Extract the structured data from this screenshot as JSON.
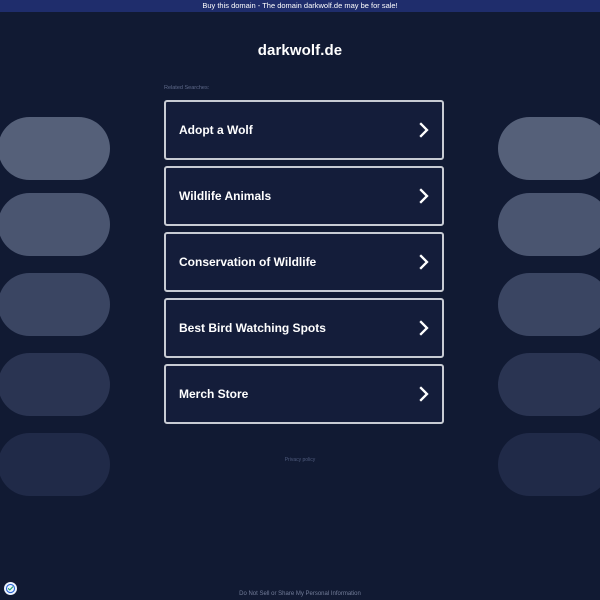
{
  "banner": {
    "text": "Buy this domain - The domain darkwolf.de may be for sale!"
  },
  "site": {
    "title": "darkwolf.de"
  },
  "related": {
    "label": "Related Searches:",
    "items": [
      {
        "label": "Adopt a Wolf",
        "icon": "chevron-right-icon"
      },
      {
        "label": "Wildlife Animals",
        "icon": "chevron-right-icon"
      },
      {
        "label": "Conservation of Wildlife",
        "icon": "chevron-right-icon"
      },
      {
        "label": "Best Bird Watching Spots",
        "icon": "chevron-right-icon"
      },
      {
        "label": "Merch Store",
        "icon": "chevron-right-icon"
      }
    ]
  },
  "links": {
    "privacy_policy": "Privacy policy",
    "do_not_sell": "Do Not Sell or Share My Personal Information"
  },
  "icons": {
    "consent": "consent-check-icon",
    "chevron": "chevron-right-icon"
  },
  "colors": {
    "background": "#111a33",
    "banner": "#1f2d6c",
    "card_border": "#c7cbd3",
    "pill_1": "#556079",
    "pill_2": "#4a5570",
    "pill_3": "#3a4562",
    "pill_4": "#2a3452",
    "pill_5": "#202a48"
  }
}
